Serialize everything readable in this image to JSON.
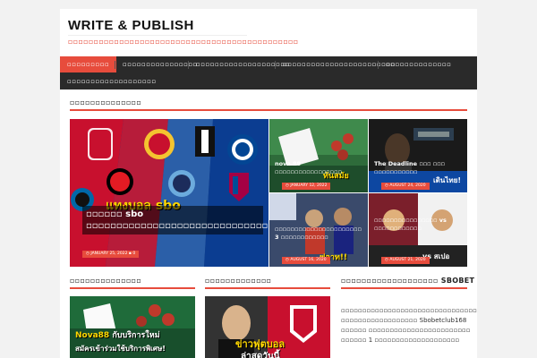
{
  "site": {
    "title": "WRITE & PUBLISH",
    "tagline": "▫▫▫▫▫▫▫▫▫▫▫▫▫▫▫▫▫▫▫▫▫▫▫▫▫▫▫▫▫▫▫▫▫▫▫▫▫▫▫▫▫▫▫▫▫"
  },
  "nav": {
    "items": [
      "▫▫▫▫▫▫▫▫▫",
      "▫▫▫▫▫▫▫▫▫▫▫▫▫▫▫▫",
      "▫▫▫▫▫▫▫▫▫▫▫▫▫▫▫▫▫▫▫▫",
      "▫▫▫▫▫▫▫▫▫▫▫▫▫▫▫▫▫▫▫▫▫▫▫▫",
      "▫▫▫▫▫▫▫▫▫▫▫▫▫▫",
      "▫▫▫▫▫▫▫▫▫▫▫▫▫▫▫▫▫▫▫"
    ],
    "active_index": 0
  },
  "featured": {
    "section_title": "▫▫▫▫▫▫▫▫▫▫▫▫▫▫",
    "big": {
      "title": "▫▫▫▫▫▫ sbo ▫▫▫▫▫▫▫▫▫▫▫▫▫▫▫▫▫▫▫▫▫▫▫▫▫▫▫▫▫▫▫▫▫▫▫▫▫",
      "date": "JANUARY 25, 2022",
      "comments": "0",
      "banner_text": "แทงบอล sbo"
    },
    "tiles": [
      {
        "title": "nova 88 ▫▫▫▫▫▫▫▫▫▫▫▫▫▫▫▫▫",
        "date": "JANUARY 12, 2022",
        "overlay": "ทันสมัย"
      },
      {
        "title": "The Deadline ▫▫▫ ▫▫▫ ▫▫▫▫▫▫▫▫▫▫▫",
        "date": "AUGUST 24, 2020",
        "overlay": "เดินไทย!"
      },
      {
        "title": "▫▫▫▫▫▫▫▫▫▫▫▫▫▫▫▫▫▫▫▫▫▫ 3 ▫▫▫▫▫▫▫▫▫▫▫▫",
        "date": "AUGUST 16, 2020",
        "overlay": "ฟลาท!!"
      },
      {
        "title": "▫▫▫▫▫▫▫▫▫▫▫▫▫▫▫▫ vs ▫▫▫▫▫▫▫▫▫▫▫▫",
        "date": "AUGUST 21, 2020",
        "overlay": "vs สเปอ"
      }
    ]
  },
  "columns": [
    {
      "title": "▫▫▫▫▫▫▫▫▫▫▫▫▫▫",
      "image_text_1": "Nova88",
      "image_text_2": "กับบริการใหม่",
      "image_text_3": "สมัครเข้าร่วมใช้บริการพิเศษ!"
    },
    {
      "title": "▫▫▫▫▫▫▫▫▫▫▫▫▫",
      "image_text_1": "ข่าวฟุตบอล",
      "image_text_2": "ล่าสุดวันนี้"
    },
    {
      "title": "▫▫▫▫▫▫▫▫▫▫▫▫▫▫▫▫▫▫▫ SBOBET"
    }
  ],
  "sidebar_text": "▫▫▫▫▫▫▫▫▫▫▫▫▫▫▫▫▫▫▫▫▫▫▫▫▫▫▫▫▫▫▫▫▫▫▫▫▫▫▫▫▫▫▫▫▫▫▫ ▫▫▫▫▫▫▫▫▫▫▫▫▫▫▫▫▫▫ Sbobetclub168 ▫▫▫▫▫▫ ▫▫▫▫▫▫▫▫▫▫▫▫▫▫▫▫▫▫▫▫▫▫▫▫ ▫▫▫▫▫▫ 1 ▫▫▫▫▫▫▫▫▫▫▫▫▫▫▫▫▫▫▫▫",
  "colors": {
    "accent": "#e74c3c",
    "nav_bg": "#2a2a2a",
    "page_bg": "#f2f2f2"
  }
}
